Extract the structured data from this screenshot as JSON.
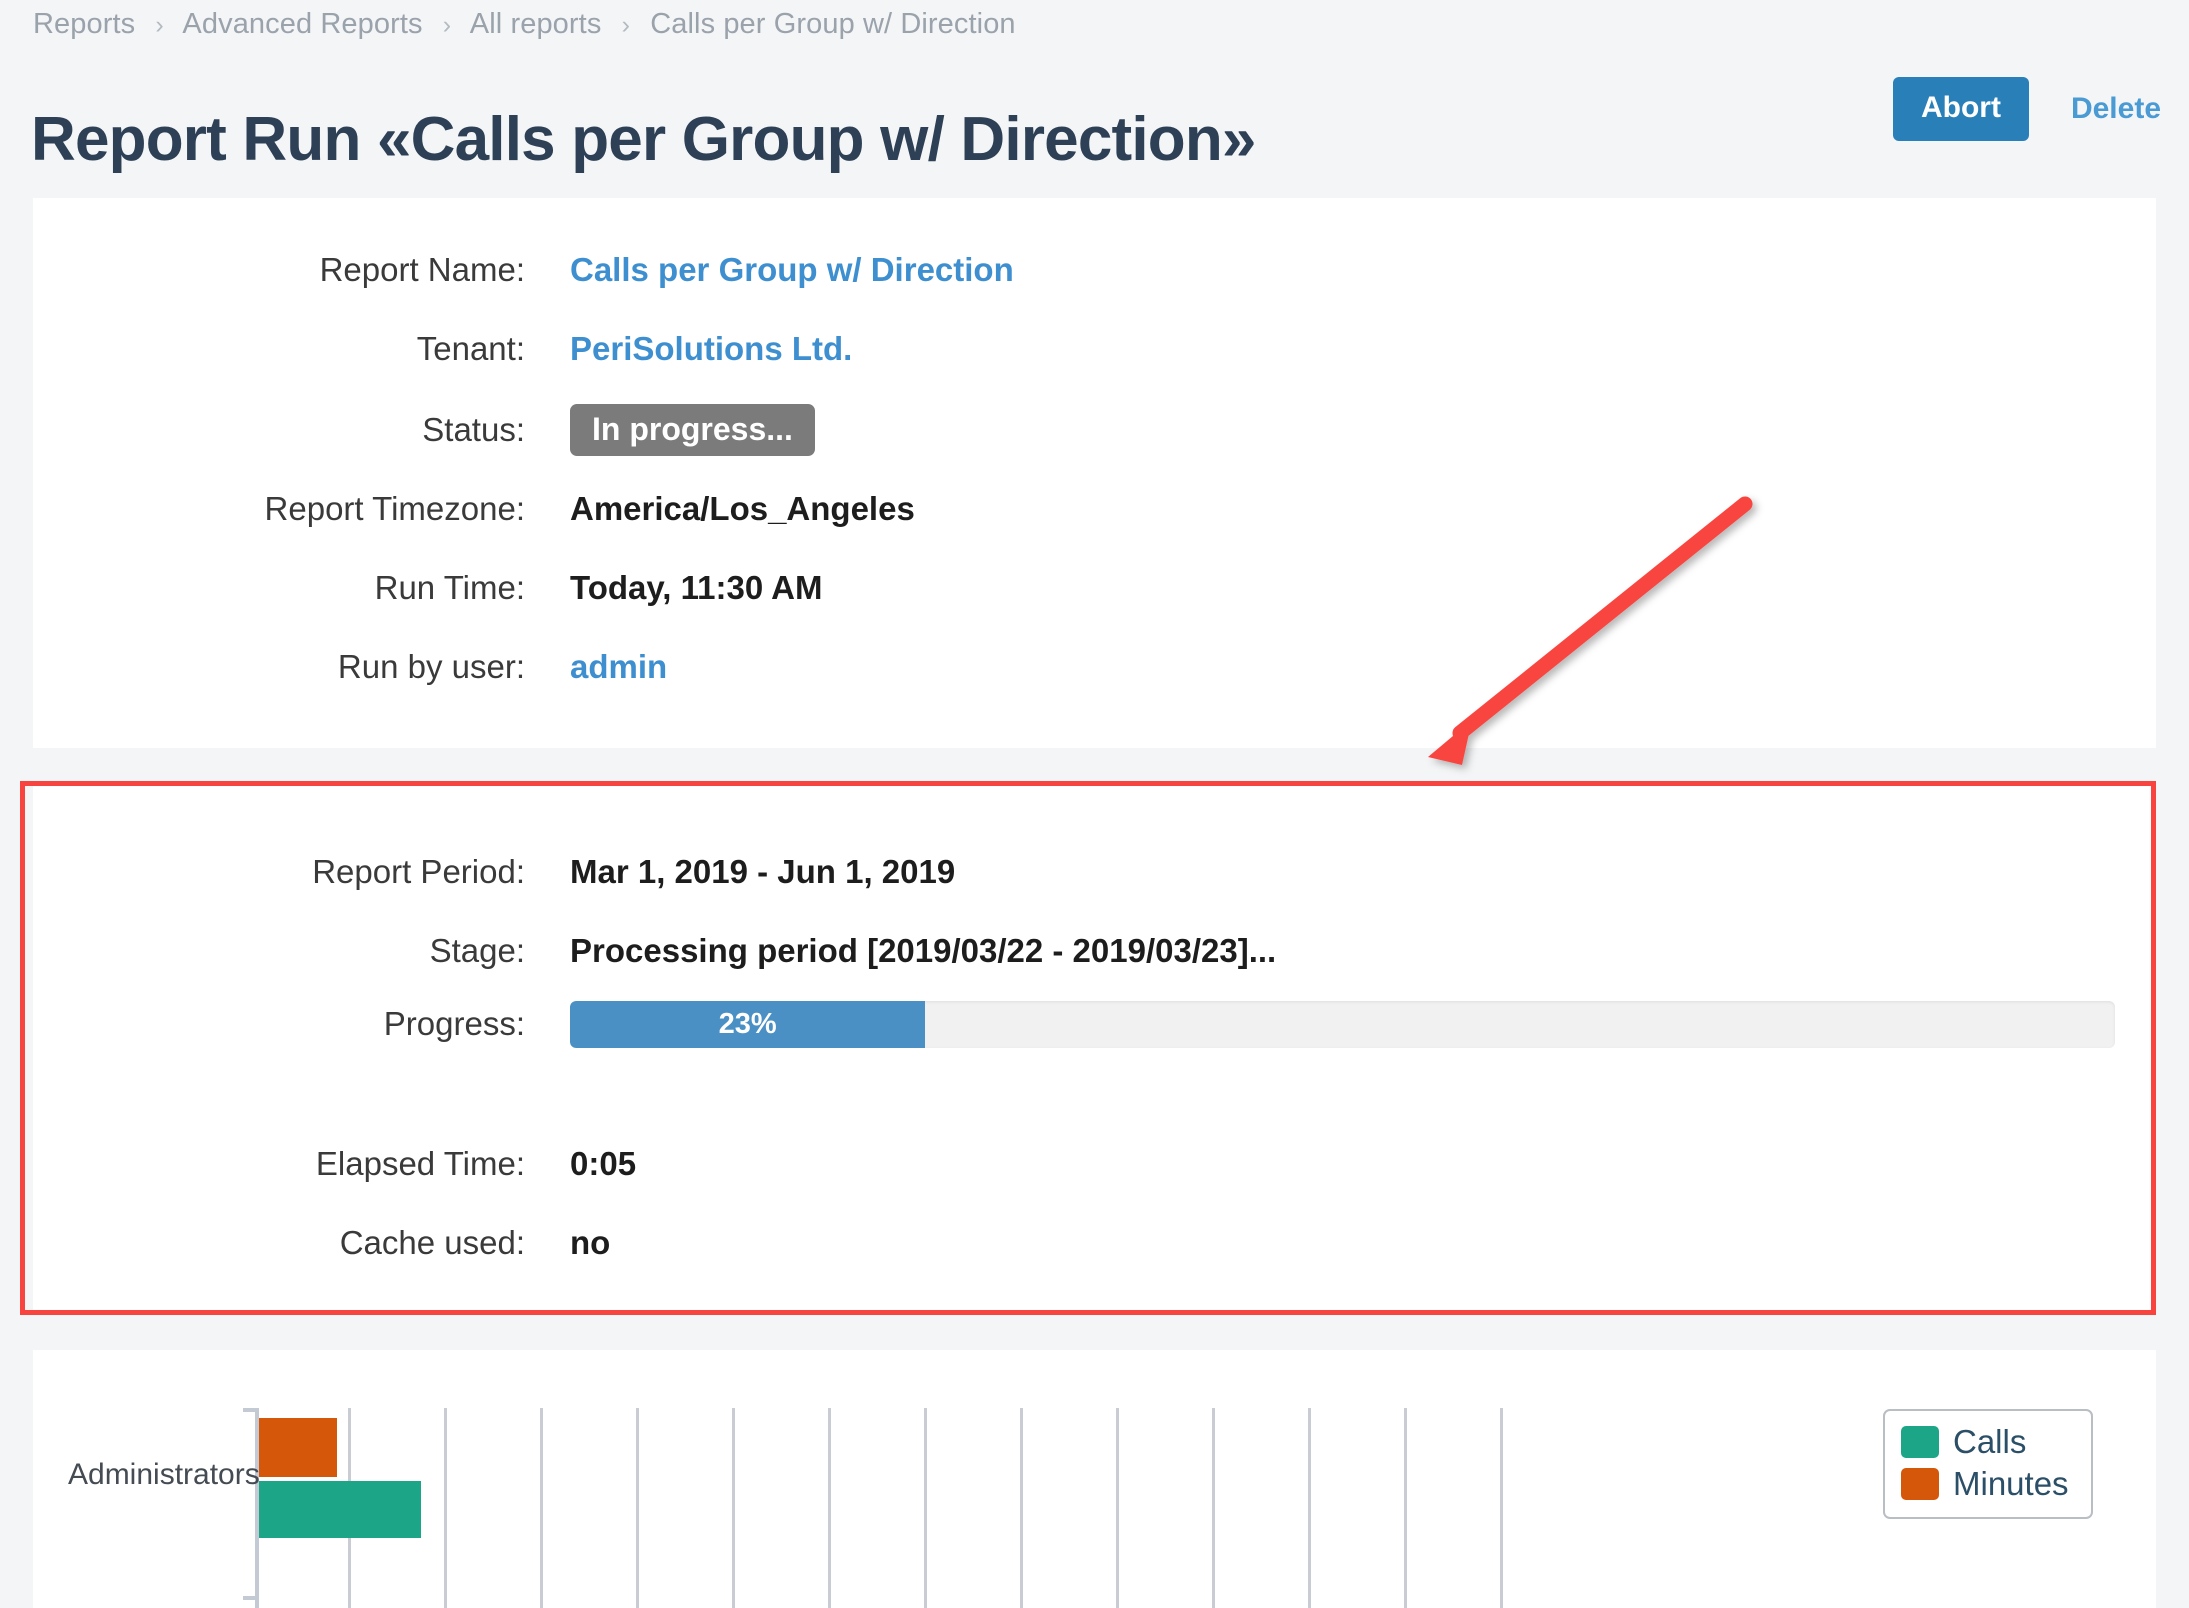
{
  "breadcrumb": {
    "items": [
      "Reports",
      "Advanced Reports",
      "All reports",
      "Calls per Group w/ Direction"
    ],
    "separator": "›"
  },
  "header": {
    "title": "Report Run «Calls per Group w/ Direction»",
    "abort_label": "Abort",
    "delete_label": "Delete",
    "abort_color": "#2980b9",
    "delete_color": "#4a9ad4"
  },
  "info": {
    "report_name_label": "Report Name:",
    "report_name_value": "Calls per Group w/ Direction",
    "tenant_label": "Tenant:",
    "tenant_value": "PeriSolutions Ltd.",
    "status_label": "Status:",
    "status_value": "In progress...",
    "status_color": "#7b7b7b",
    "timezone_label": "Report Timezone:",
    "timezone_value": "America/Los_Angeles",
    "run_time_label": "Run Time:",
    "run_time_value": "Today, 11:30 AM",
    "run_by_label": "Run by user:",
    "run_by_value": "admin"
  },
  "stage": {
    "report_period_label": "Report Period:",
    "report_period_value": "Mar 1, 2019 - Jun 1, 2019",
    "stage_label": "Stage:",
    "stage_value": "Processing period [2019/03/22 - 2019/03/23]...",
    "progress_label": "Progress:",
    "progress_percent": 23,
    "progress_text": "23%",
    "progress_color": "#4a90c4",
    "elapsed_label": "Elapsed Time:",
    "elapsed_value": "0:05",
    "cache_label": "Cache used:",
    "cache_value": "no"
  },
  "annotation": {
    "highlight_color": "#f8443f",
    "arrow_color": "#f8443f"
  },
  "chart_data": {
    "type": "bar",
    "orientation": "horizontal",
    "categories": [
      "Administrators"
    ],
    "series": [
      {
        "name": "Calls",
        "values": [
          1.7
        ],
        "color": "#1ca687"
      },
      {
        "name": "Minutes",
        "values": [
          1.0
        ],
        "color": "#d4570a"
      }
    ],
    "title": "",
    "xlabel": "",
    "ylabel": "",
    "grid": true,
    "legend_position": "top-right",
    "legend_entries": [
      "Calls",
      "Minutes"
    ],
    "gridline_count": 13
  }
}
